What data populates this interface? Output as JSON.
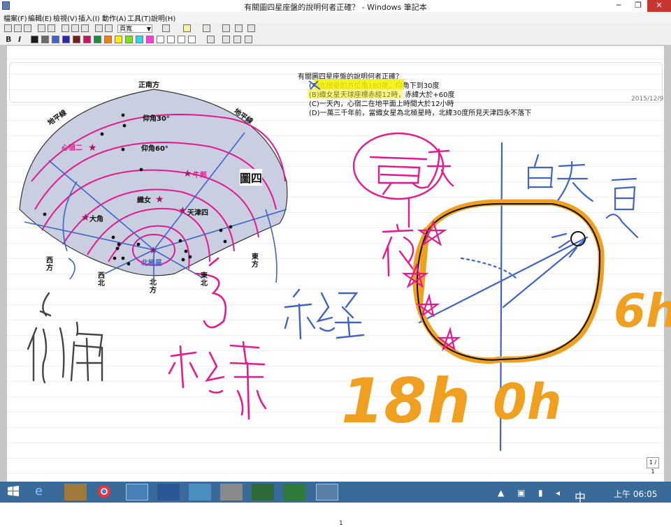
{
  "window": {
    "title": "有關圖四星座盤的說明何者正確？ - Windows 筆記本",
    "min_label": "─",
    "max_label": "❐",
    "close_label": "✕"
  },
  "menu": [
    "檔案(F)",
    "編輯(E)",
    "檢視(V)",
    "插入(I)",
    "動作(A)",
    "工具(T)",
    "說明(H)"
  ],
  "toolbar": {
    "zoom_value": "頁寬",
    "bold": "B",
    "italic": "I",
    "colors": [
      "#1b1b1b",
      "#6a6a6a",
      "#3f63c8",
      "#2a2aa0",
      "#7a1a1a",
      "#c0185a",
      "#1d8a3c",
      "#e8831a",
      "#ffee00",
      "#80e020",
      "#29d6f0",
      "#ff3fd4",
      "#ffffff",
      "#ffffff",
      "#ffffff",
      "#ffffff"
    ]
  },
  "question": {
    "title": "有關圖四星座盤的說明何者正確？",
    "options": [
      "(A)北極星的方位角180度，仰角下到30度",
      "(B)織女星天球座標赤經12時，赤緯大於+60度",
      "(C)一天內，心宿二在地平面上時間大於12小時",
      "(D)一萬三千年前，當織女星為北極星時，北緯30度所見天津四永不落下"
    ],
    "date": "2015/12/9"
  },
  "diagram": {
    "south": "正南方",
    "horizon_left": "地平線",
    "horizon_right": "地平線",
    "alt30": "仰角30°",
    "alt60": "仰角60°",
    "fig": "圖四",
    "antares": "心宿二",
    "altair": "牛郎",
    "vega": "織女",
    "deneb": "天津四",
    "arcturus": "大角",
    "polaris": "北極星",
    "west": "西方",
    "nw": "西北",
    "north": "北方",
    "ne": "東北",
    "east": "東方"
  },
  "handwriting": {
    "elevation": "仰角",
    "dec": "赤緯",
    "ra": "赤經",
    "three": "3",
    "summer_day": "夏天",
    "night": "夜",
    "day": "白天",
    "summer": "夏",
    "h18": "18h",
    "h0": "0h",
    "h6": "6h"
  },
  "page_footer": {
    "page_indicator": "1 / 1",
    "page_number": "1"
  },
  "taskbar": {
    "ime": "中",
    "time": "上午 06:05"
  },
  "colors": {
    "taskbar": "#3a6a9a",
    "pink": "#d6198f",
    "blue": "#3f63c8",
    "orange": "#f0a020",
    "highlight": "#f6f200"
  }
}
